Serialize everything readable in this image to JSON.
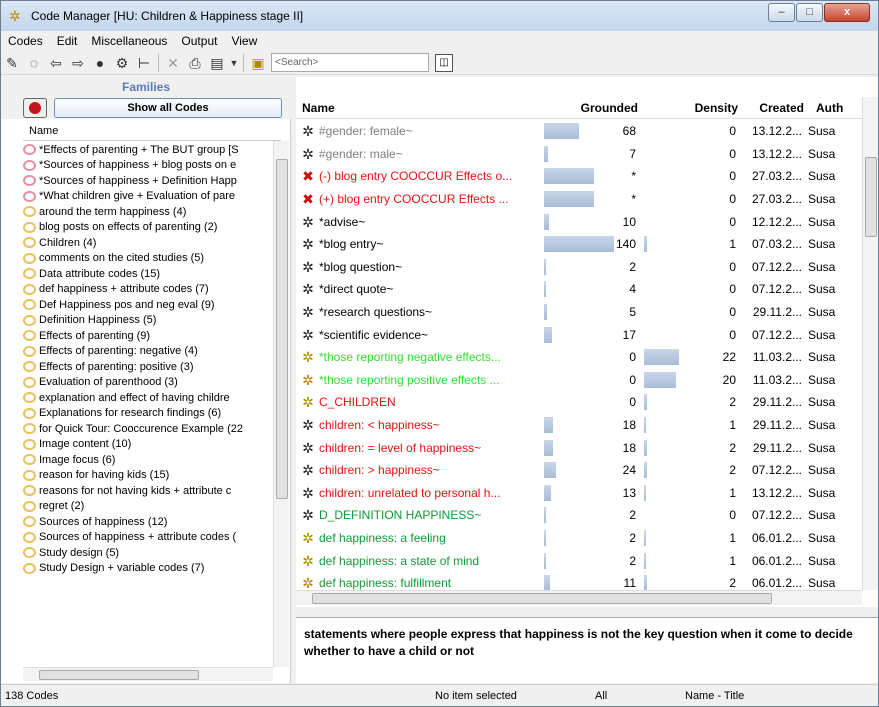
{
  "window": {
    "title": "Code Manager [HU: Children & Happiness stage II]",
    "min": "‒",
    "max": "□",
    "close": "x"
  },
  "menu": [
    "Codes",
    "Edit",
    "Miscellaneous",
    "Output",
    "View"
  ],
  "toolbar": {
    "search_placeholder": "<Search>"
  },
  "families": {
    "title": "Families",
    "show_all": "Show all Codes",
    "name_header": "Name",
    "items": [
      {
        "label": "*Effects of parenting + The BUT group [S",
        "pink": true
      },
      {
        "label": "*Sources of happiness + blog posts on e",
        "pink": true
      },
      {
        "label": "*Sources of happiness + Definition Happ",
        "pink": true
      },
      {
        "label": "*What children give + Evaluation of pare",
        "pink": true
      },
      {
        "label": "around the term happiness (4)"
      },
      {
        "label": "blog posts on effects of parenting (2)"
      },
      {
        "label": "Children (4)"
      },
      {
        "label": "comments on the cited studies (5)"
      },
      {
        "label": "Data attribute codes (15)"
      },
      {
        "label": "def happiness + attribute codes (7)"
      },
      {
        "label": "Def Happiness pos and neg eval (9)"
      },
      {
        "label": "Definition Happiness (5)"
      },
      {
        "label": "Effects of parenting (9)"
      },
      {
        "label": "Effects of parenting: negative (4)"
      },
      {
        "label": "Effects of parenting: positive (3)"
      },
      {
        "label": "Evaluation of parenthood (3)"
      },
      {
        "label": "explanation and effect of having childre"
      },
      {
        "label": "Explanations for research findings (6)"
      },
      {
        "label": "for Quick Tour: Cooccurence Example (22"
      },
      {
        "label": "Image content (10)"
      },
      {
        "label": "Image focus (6)"
      },
      {
        "label": "reason for having kids (15)"
      },
      {
        "label": "reasons for not having kids + attribute c"
      },
      {
        "label": "regret (2)"
      },
      {
        "label": "Sources of happiness (12)"
      },
      {
        "label": "Sources of happiness + attribute codes ("
      },
      {
        "label": "Study design (5)"
      },
      {
        "label": "Study Design + variable codes (7)"
      }
    ]
  },
  "codes": {
    "headers": {
      "name": "Name",
      "grounded": "Grounded",
      "density": "Density",
      "created": "Created",
      "author": "Auth"
    },
    "rows": [
      {
        "icon": "codes-group-icon",
        "name": "#gender: female~",
        "color": "#808080",
        "grounded": "68",
        "gfill": 0.35,
        "density": "0",
        "dfill": 0,
        "created": "13.12.2...",
        "author": "Susa"
      },
      {
        "icon": "codes-group-icon",
        "name": "#gender: male~",
        "color": "#808080",
        "grounded": "7",
        "gfill": 0.04,
        "density": "0",
        "dfill": 0,
        "created": "13.12.2...",
        "author": "Susa"
      },
      {
        "icon": "red-code-icon",
        "name": "(-) blog entry COOCCUR Effects o...",
        "color": "#e81010",
        "grounded": "*",
        "gfill": 0.5,
        "density": "0",
        "dfill": 0,
        "created": "27.03.2...",
        "author": "Susa"
      },
      {
        "icon": "red-code-icon",
        "name": "(+) blog entry COOCCUR Effects ...",
        "color": "#e81010",
        "grounded": "*",
        "gfill": 0.5,
        "density": "0",
        "dfill": 0,
        "created": "27.03.2...",
        "author": "Susa"
      },
      {
        "icon": "codes-group-icon",
        "name": "*advise~",
        "color": "#000000",
        "grounded": "10",
        "gfill": 0.05,
        "density": "0",
        "dfill": 0,
        "created": "12.12.2...",
        "author": "Susa"
      },
      {
        "icon": "codes-group-icon",
        "name": "*blog entry~",
        "color": "#000000",
        "grounded": "140",
        "gfill": 0.7,
        "density": "1",
        "dfill": 0.03,
        "created": "07.03.2...",
        "author": "Susa"
      },
      {
        "icon": "codes-group-icon",
        "name": "*blog question~",
        "color": "#000000",
        "grounded": "2",
        "gfill": 0.02,
        "density": "0",
        "dfill": 0,
        "created": "07.12.2...",
        "author": "Susa"
      },
      {
        "icon": "codes-group-icon",
        "name": "*direct quote~",
        "color": "#000000",
        "grounded": "4",
        "gfill": 0.02,
        "density": "0",
        "dfill": 0,
        "created": "07.12.2...",
        "author": "Susa"
      },
      {
        "icon": "codes-group-icon",
        "name": "*research questions~",
        "color": "#000000",
        "grounded": "5",
        "gfill": 0.03,
        "density": "0",
        "dfill": 0,
        "created": "29.11.2...",
        "author": "Susa"
      },
      {
        "icon": "codes-group-icon",
        "name": "*scientific evidence~",
        "color": "#000000",
        "grounded": "17",
        "gfill": 0.08,
        "density": "0",
        "dfill": 0,
        "created": "07.12.2...",
        "author": "Susa"
      },
      {
        "icon": "star-code-icon",
        "name": "*those reporting negative effects...",
        "color": "#33dd33",
        "grounded": "0",
        "gfill": 0,
        "density": "22",
        "dfill": 0.35,
        "created": "11.03.2...",
        "author": "Susa"
      },
      {
        "icon": "star-code-icon",
        "name": "*those reporting positive effects ...",
        "color": "#33dd33",
        "grounded": "0",
        "gfill": 0,
        "density": "20",
        "dfill": 0.32,
        "created": "11.03.2...",
        "author": "Susa"
      },
      {
        "icon": "star-code-icon",
        "name": "C_CHILDREN",
        "color": "#e81010",
        "grounded": "0",
        "gfill": 0,
        "density": "2",
        "dfill": 0.03,
        "created": "29.11.2...",
        "author": "Susa"
      },
      {
        "icon": "codes-group-icon",
        "name": "children: < happiness~",
        "color": "#e81010",
        "grounded": "18",
        "gfill": 0.09,
        "density": "1",
        "dfill": 0.02,
        "created": "29.11.2...",
        "author": "Susa"
      },
      {
        "icon": "codes-group-icon",
        "name": "children: = level of happiness~",
        "color": "#e81010",
        "grounded": "18",
        "gfill": 0.09,
        "density": "2",
        "dfill": 0.03,
        "created": "29.11.2...",
        "author": "Susa"
      },
      {
        "icon": "codes-group-icon",
        "name": "children: > happiness~",
        "color": "#e81010",
        "grounded": "24",
        "gfill": 0.12,
        "density": "2",
        "dfill": 0.03,
        "created": "07.12.2...",
        "author": "Susa"
      },
      {
        "icon": "codes-group-icon",
        "name": "children: unrelated to personal h...",
        "color": "#e81010",
        "grounded": "13",
        "gfill": 0.07,
        "density": "1",
        "dfill": 0.02,
        "created": "13.12.2...",
        "author": "Susa"
      },
      {
        "icon": "codes-group-icon",
        "name": "D_DEFINITION HAPPINESS~",
        "color": "#119933",
        "grounded": "2",
        "gfill": 0.02,
        "density": "0",
        "dfill": 0,
        "created": "07.12.2...",
        "author": "Susa"
      },
      {
        "icon": "star-code-icon",
        "name": "def happiness: a feeling",
        "color": "#119933",
        "grounded": "2",
        "gfill": 0.02,
        "density": "1",
        "dfill": 0.02,
        "created": "06.01.2...",
        "author": "Susa"
      },
      {
        "icon": "star-code-icon",
        "name": "def happiness: a state of mind",
        "color": "#119933",
        "grounded": "2",
        "gfill": 0.02,
        "density": "1",
        "dfill": 0.02,
        "created": "06.01.2...",
        "author": "Susa"
      },
      {
        "icon": "star-code-icon",
        "name": "def happiness: fulfillment",
        "color": "#119933",
        "grounded": "11",
        "gfill": 0.06,
        "density": "2",
        "dfill": 0.03,
        "created": "06.01.2...",
        "author": "Susa"
      }
    ]
  },
  "comment": "statements where people express that happiness is not the key question when it come to decide whether to have a child or not",
  "status": {
    "count": "138 Codes",
    "selection": "No item selected",
    "filter": "All",
    "sort": "Name - Title"
  }
}
